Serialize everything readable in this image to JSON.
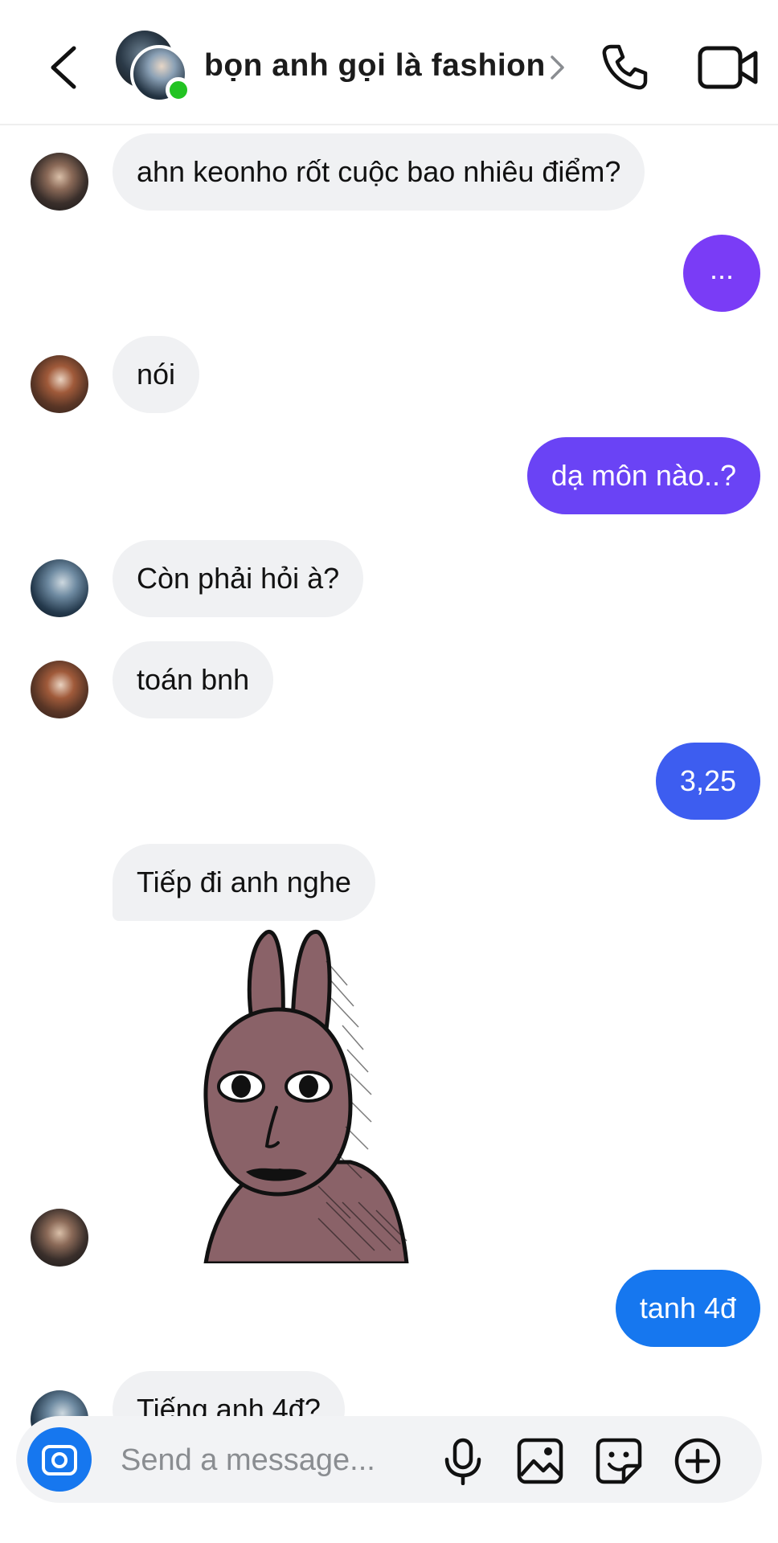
{
  "header": {
    "title": "bọn anh gọi là fashion",
    "back_icon": "chevron-left-icon",
    "call_icon": "phone-icon",
    "video_icon": "video-camera-icon",
    "online_color": "#22c322"
  },
  "messages": [
    {
      "side": "in",
      "text": "ahn keonho rốt cuộc bao nhiêu điểm?"
    },
    {
      "side": "out",
      "text": "...",
      "color": "#7a3cf6"
    },
    {
      "side": "in",
      "text": "nói"
    },
    {
      "side": "out",
      "text": "dạ môn nào..?",
      "color": "#6a43f5"
    },
    {
      "side": "in",
      "text": "Còn phải hỏi à?"
    },
    {
      "side": "in",
      "text": "toán bnh"
    },
    {
      "side": "out",
      "text": "3,25",
      "color": "#3d5df0"
    },
    {
      "side": "in",
      "text": "Tiếp đi anh nghe"
    },
    {
      "side": "in",
      "type": "sticker",
      "sticker": "brown-rabbit-sticker"
    },
    {
      "side": "out",
      "text": "tanh 4đ",
      "color": "#1677ef"
    },
    {
      "side": "in",
      "text": "Tiếng anh 4đ?"
    }
  ],
  "composer": {
    "placeholder": "Send a message...",
    "camera_icon": "camera-icon",
    "tools": [
      "microphone-icon",
      "image-icon",
      "sticker-icon",
      "plus-circle-icon"
    ],
    "accent": "#1677ef"
  }
}
